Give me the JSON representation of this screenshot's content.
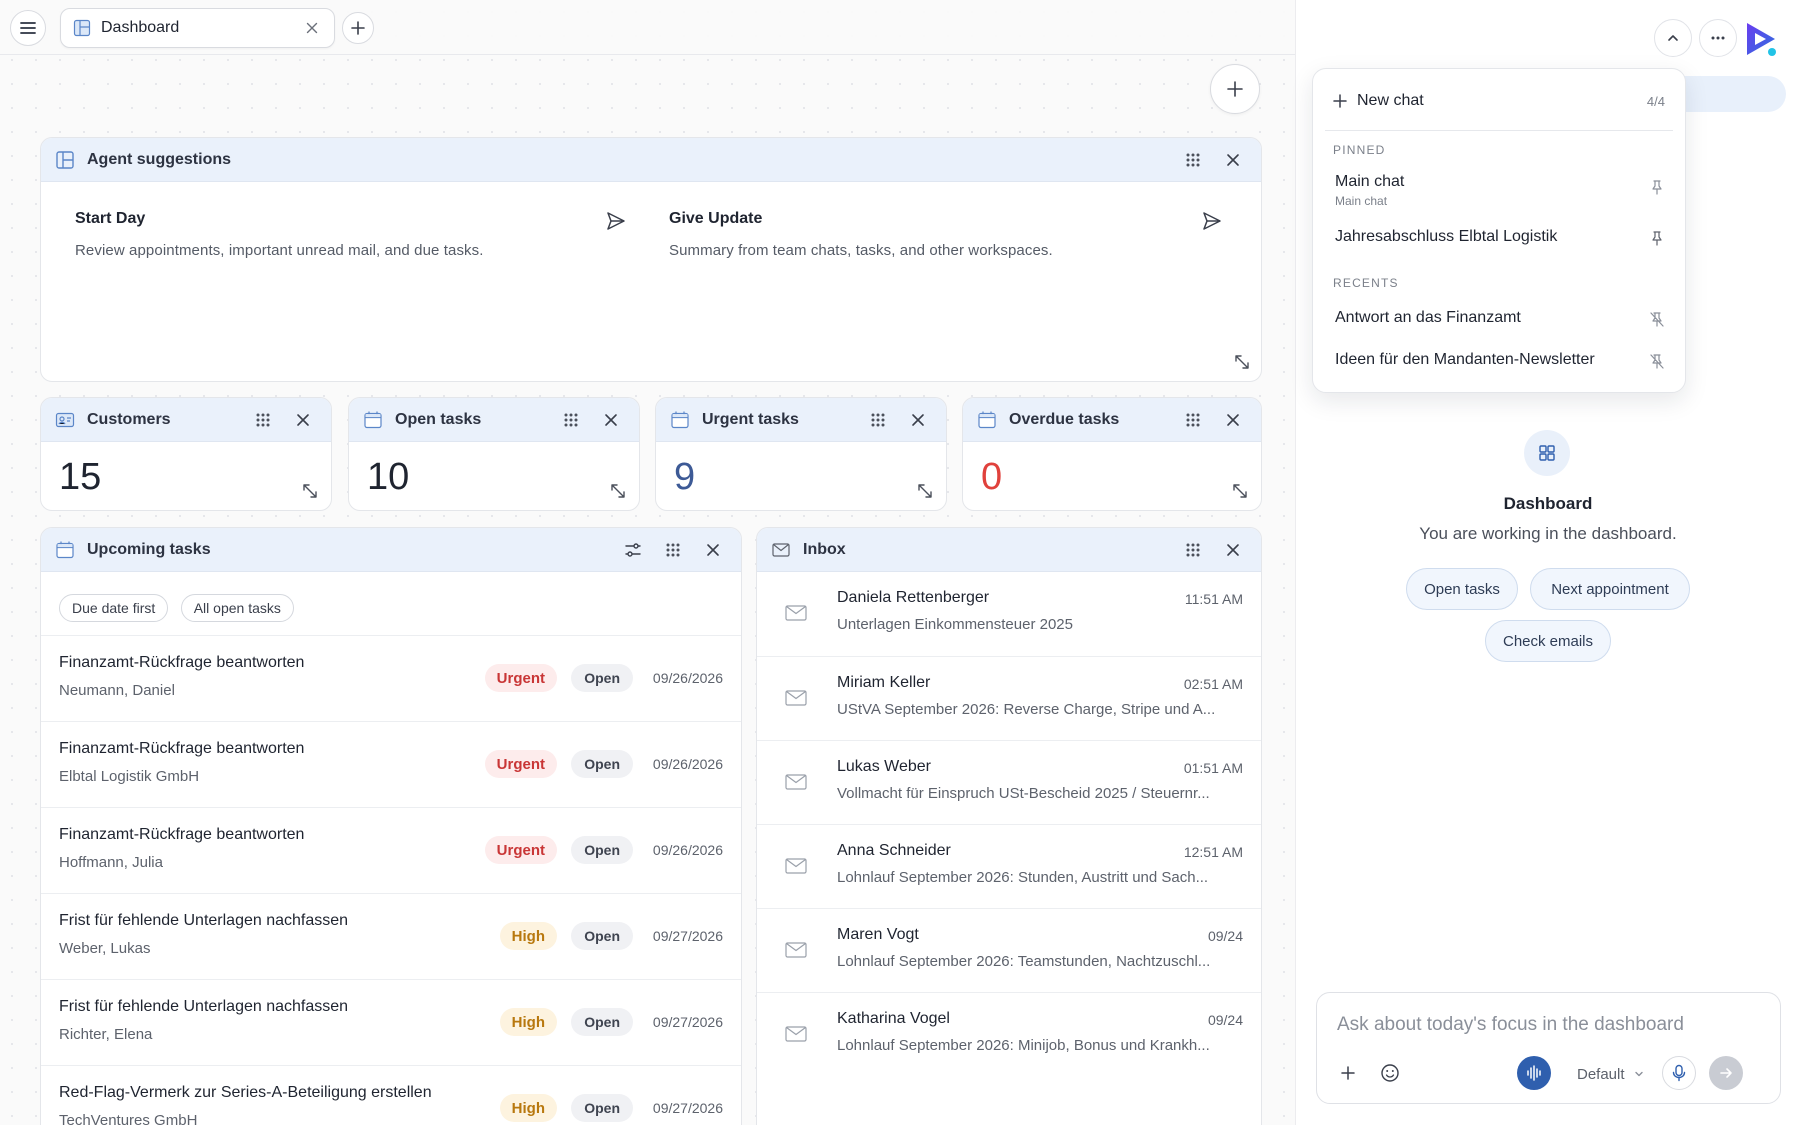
{
  "tabbar": {
    "tab_label": "Dashboard"
  },
  "agent_suggestions": {
    "title": "Agent suggestions",
    "cards": [
      {
        "title": "Start Day",
        "description": "Review appointments, important unread mail, and due tasks."
      },
      {
        "title": "Give Update",
        "description": "Summary from team chats, tasks, and other workspaces."
      }
    ]
  },
  "stats": [
    {
      "title": "Customers",
      "value": "15",
      "color": "#1f2430"
    },
    {
      "title": "Open tasks",
      "value": "10",
      "color": "#1f2430"
    },
    {
      "title": "Urgent tasks",
      "value": "9",
      "color": "#3d5a96"
    },
    {
      "title": "Overdue tasks",
      "value": "0",
      "color": "#e0413c"
    }
  ],
  "upcoming_tasks": {
    "title": "Upcoming tasks",
    "filters": [
      "Due date first",
      "All open tasks"
    ],
    "rows": [
      {
        "title": "Finanzamt-Rückfrage beantworten",
        "client": "Neumann, Daniel",
        "priority": "Urgent",
        "status": "Open",
        "date": "09/26/2026"
      },
      {
        "title": "Finanzamt-Rückfrage beantworten",
        "client": "Elbtal Logistik GmbH",
        "priority": "Urgent",
        "status": "Open",
        "date": "09/26/2026"
      },
      {
        "title": "Finanzamt-Rückfrage beantworten",
        "client": "Hoffmann, Julia",
        "priority": "Urgent",
        "status": "Open",
        "date": "09/26/2026"
      },
      {
        "title": "Frist für fehlende Unterlagen nachfassen",
        "client": "Weber, Lukas",
        "priority": "High",
        "status": "Open",
        "date": "09/27/2026"
      },
      {
        "title": "Frist für fehlende Unterlagen nachfassen",
        "client": "Richter, Elena",
        "priority": "High",
        "status": "Open",
        "date": "09/27/2026"
      },
      {
        "title": "Red-Flag-Vermerk zur Series-A-Beteiligung erstellen",
        "client": "TechVentures GmbH",
        "priority": "High",
        "status": "Open",
        "date": "09/27/2026"
      }
    ]
  },
  "inbox": {
    "title": "Inbox",
    "rows": [
      {
        "sender": "Daniela Rettenberger",
        "time": "11:51 AM",
        "subject": "Unterlagen Einkommensteuer 2025"
      },
      {
        "sender": "Miriam Keller",
        "time": "02:51 AM",
        "subject": "UStVA September 2026: Reverse Charge, Stripe und A..."
      },
      {
        "sender": "Lukas Weber",
        "time": "01:51 AM",
        "subject": "Vollmacht für Einspruch USt-Bescheid 2025 / Steuernr..."
      },
      {
        "sender": "Anna Schneider",
        "time": "12:51 AM",
        "subject": "Lohnlauf September 2026: Stunden, Austritt und Sach..."
      },
      {
        "sender": "Maren Vogt",
        "time": "09/24",
        "subject": "Lohnlauf September 2026: Teamstunden, Nachtzuschl..."
      },
      {
        "sender": "Katharina Vogel",
        "time": "09/24",
        "subject": "Lohnlauf September 2026: Minijob, Bonus und Krankh..."
      }
    ]
  },
  "chat_menu": {
    "new_chat_label": "New chat",
    "count": "4/4",
    "pinned_label": "PINNED",
    "pinned": [
      {
        "label": "Main chat",
        "sub": "Main chat"
      },
      {
        "label": "Jahresabschluss Elbtal Logistik",
        "sub": ""
      }
    ],
    "recents_label": "RECENTS",
    "recents": [
      {
        "label": "Antwort an das Finanzamt"
      },
      {
        "label": "Ideen für den Mandanten-Newsletter"
      }
    ]
  },
  "assistant": {
    "context_title": "Dashboard",
    "context_sub": "You are working in the dashboard.",
    "quick_actions": [
      "Open tasks",
      "Next appointment",
      "Check emails"
    ],
    "input_placeholder": "Ask about today's focus in the dashboard",
    "model_label": "Default"
  },
  "colors": {
    "accent": "#2f6fdd",
    "header_bg": "#eaf1fb",
    "urgent": "#c93636",
    "high": "#b8780e",
    "overdue_zero": "#e0413c"
  }
}
